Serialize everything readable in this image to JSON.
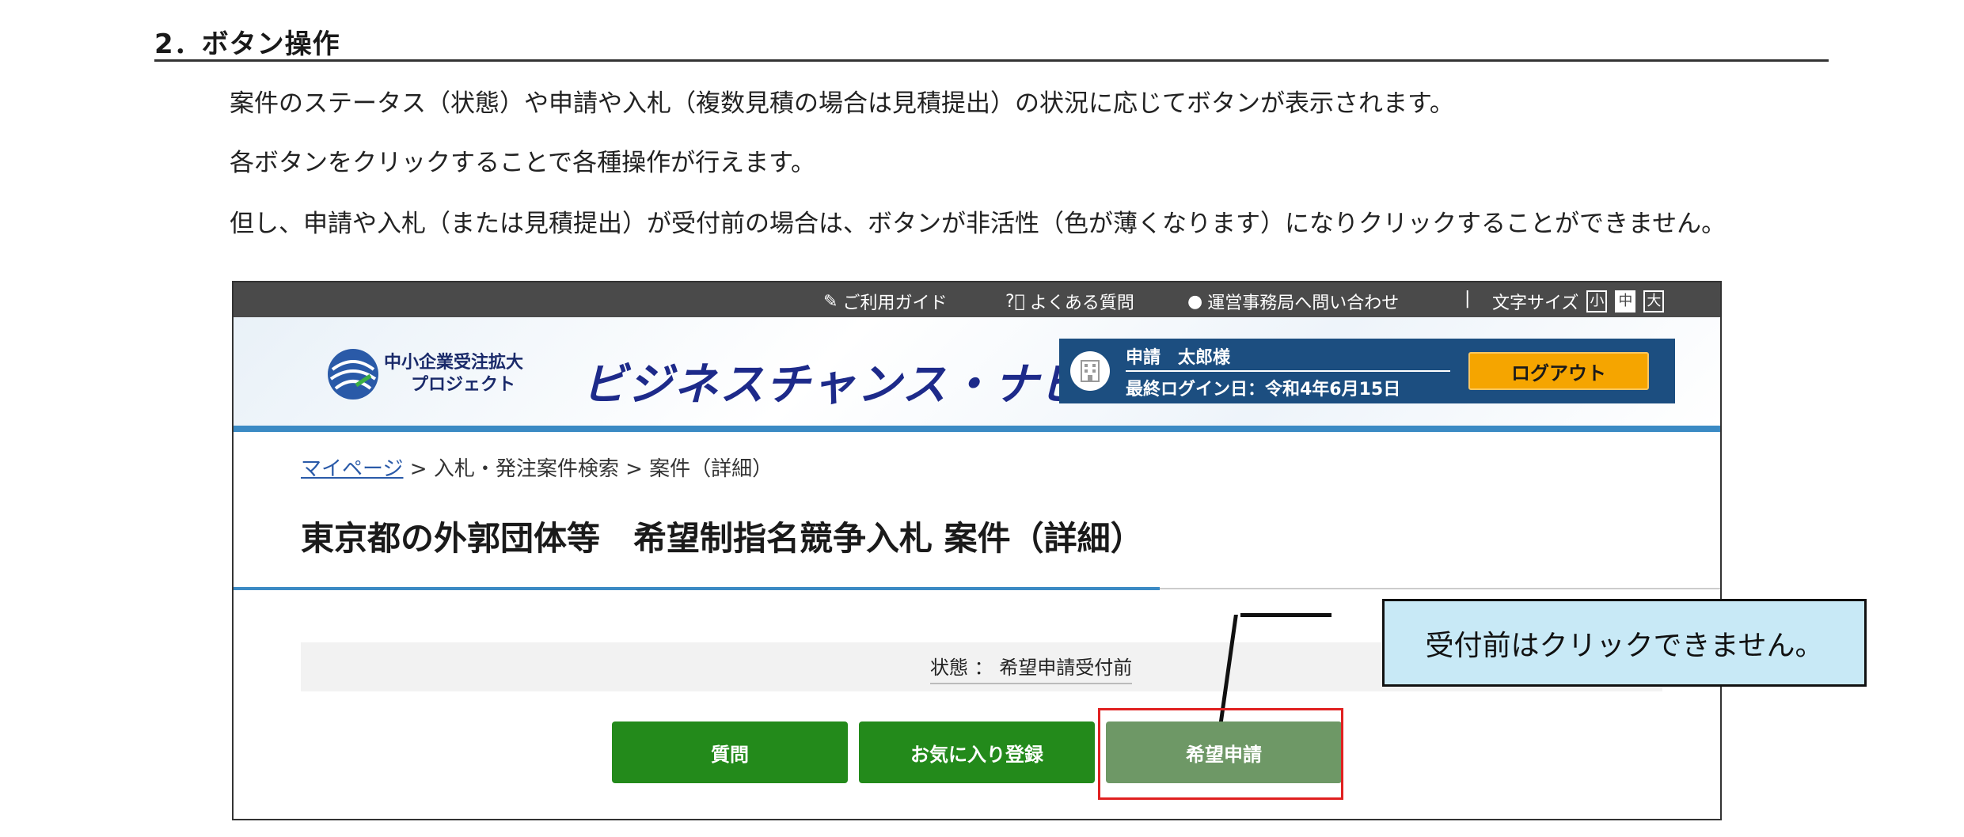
{
  "section": {
    "heading": "2．ボタン操作",
    "paragraphs": [
      "案件のステータス（状態）や申請や入札（複数見積の場合は見積提出）の状況に応じてボタンが表示されます。",
      "各ボタンをクリックすることで各種操作が行えます。",
      "但し、申請や入札（または見積提出）が受付前の場合は、ボタンが非活性（色が薄くなります）になりクリックすることができません。"
    ]
  },
  "topbar": {
    "guide": "ご利用ガイド",
    "faq": "よくある質問",
    "contact": "運営事務局へ問い合わせ",
    "separator": "|",
    "fontsize_label": "文字サイズ",
    "fontsize_small": "小",
    "fontsize_medium": "中",
    "fontsize_large": "大"
  },
  "header": {
    "logo_line1": "中小企業受注拡大",
    "logo_line2": "プロジェクト",
    "brand": "ビジネスチャンス・ナビ",
    "user_name": "申請　太郎様",
    "last_login": "最終ログイン日：令和4年6月15日",
    "logout": "ログアウト"
  },
  "breadcrumb": {
    "home": "マイページ",
    "sep1": " > ",
    "search": "入札・発注案件検索",
    "sep2": " > ",
    "current": "案件（詳細）"
  },
  "page_title": "東京都の外郭団体等　希望制指名競争入札 案件（詳細）",
  "status": "状態 ： 希望申請受付前",
  "buttons": {
    "question": "質問",
    "favorite": "お気に入り登録",
    "apply": "希望申請"
  },
  "callout": "受付前はクリックできません。",
  "colors": {
    "primary_green": "#238a1b",
    "disabled_green": "#6e9866",
    "logout_orange": "#f5a500",
    "header_blue": "#1c4e80",
    "highlight_red": "#e02020",
    "callout_bg": "#c8e9f6"
  }
}
